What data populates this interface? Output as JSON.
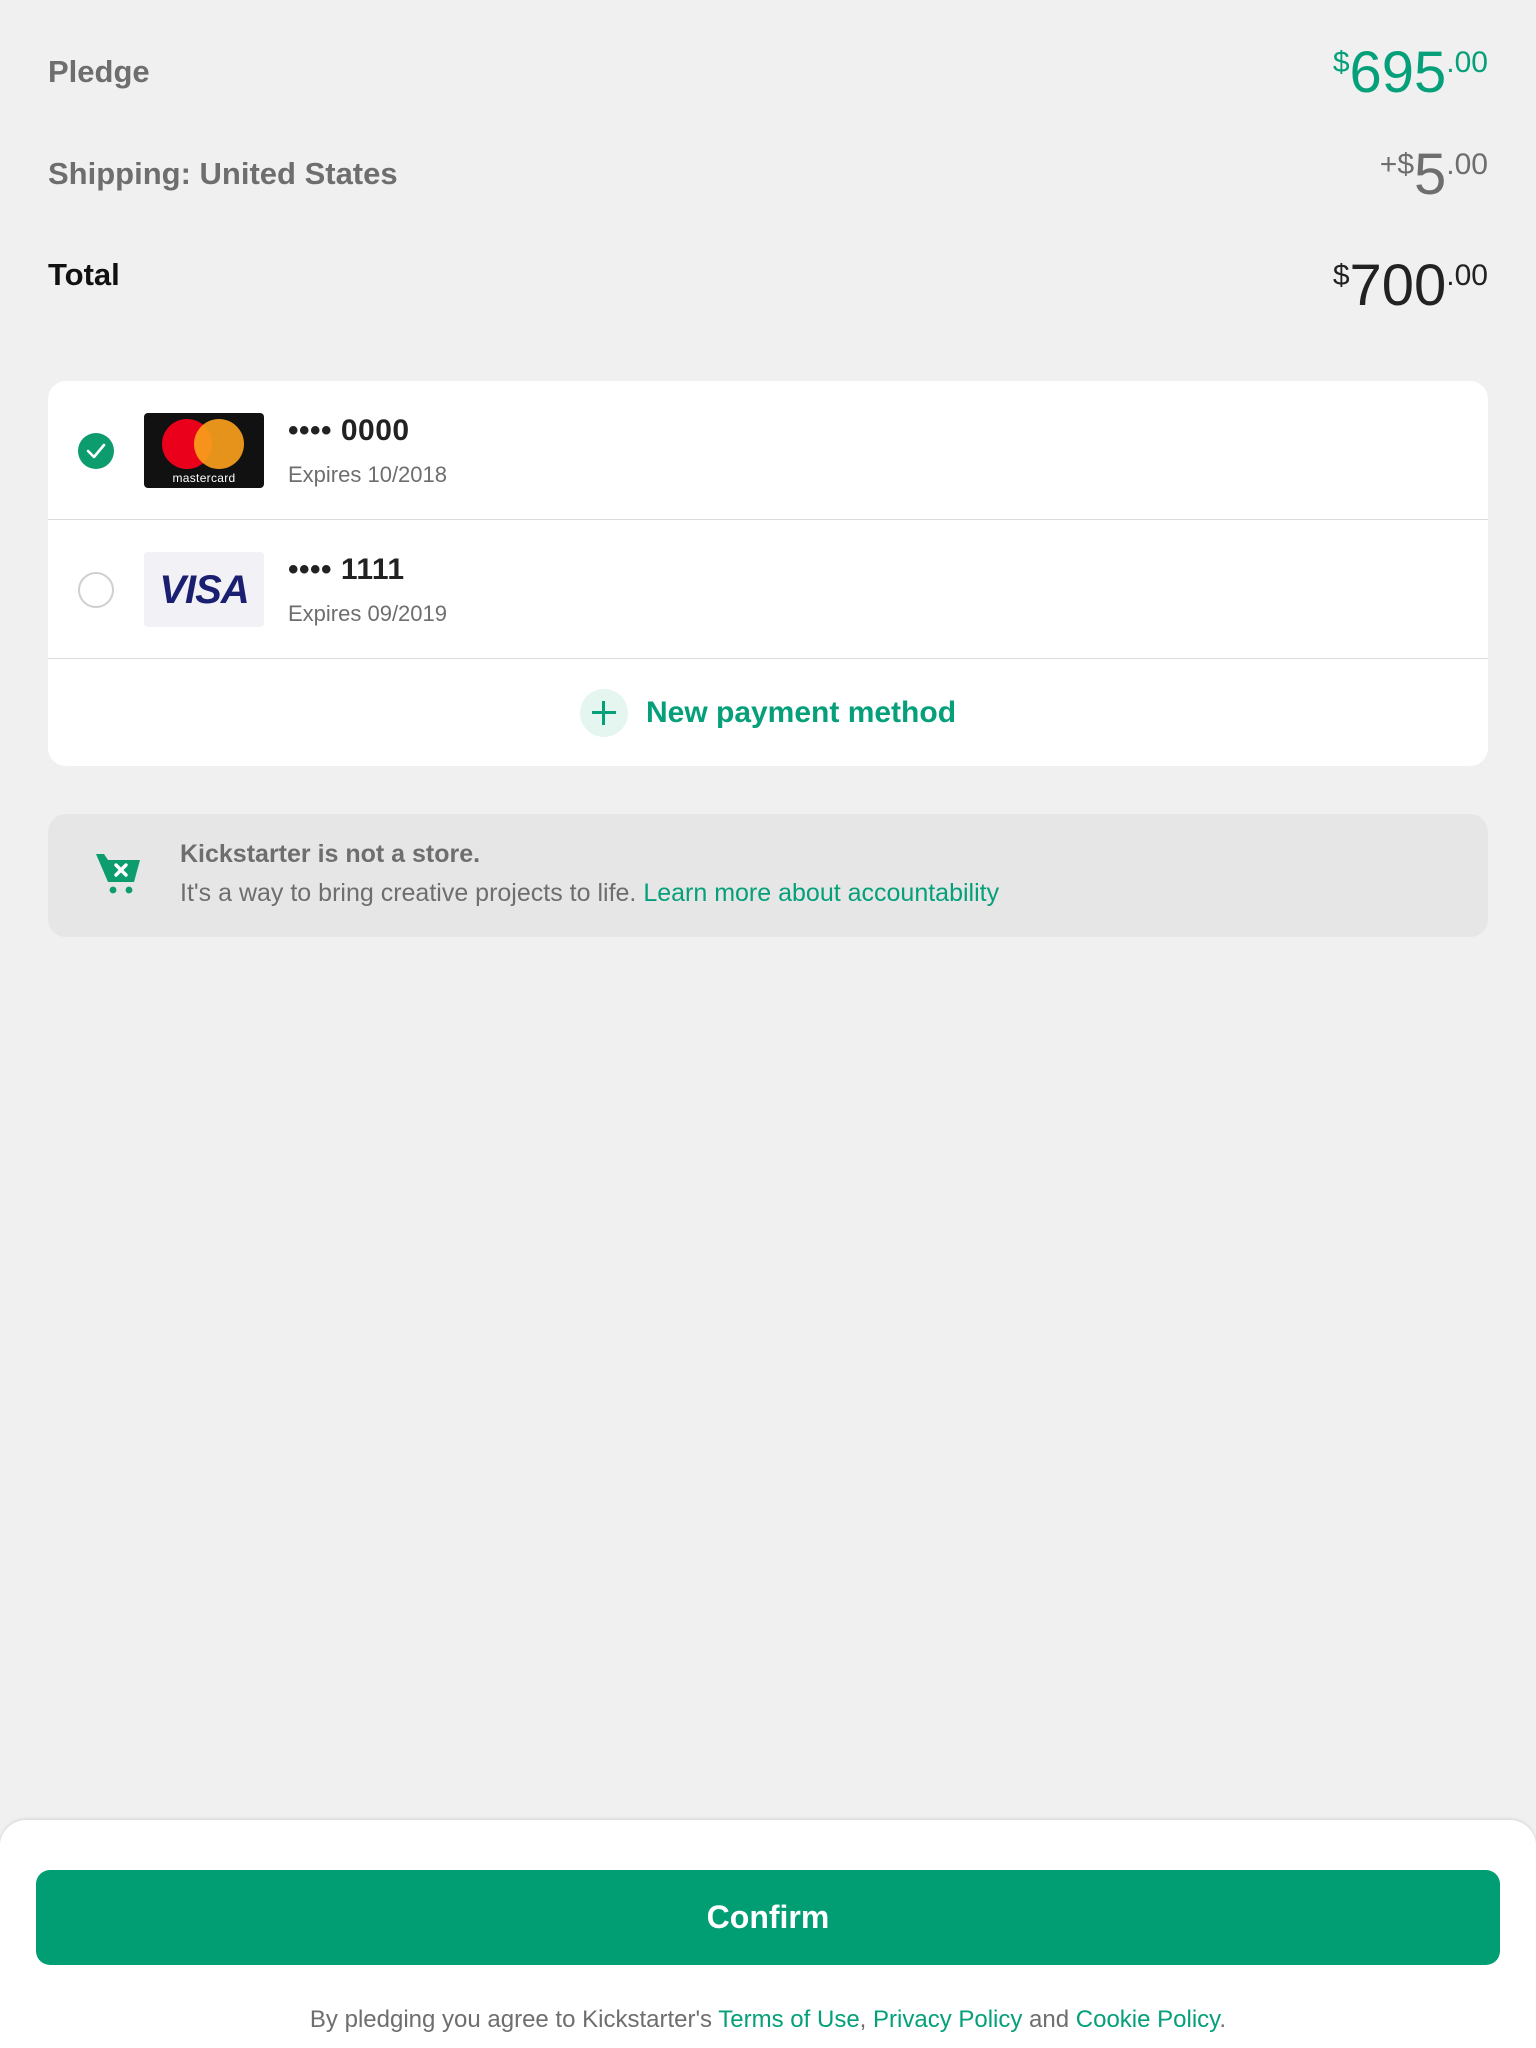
{
  "summary": {
    "pledge": {
      "label": "Pledge",
      "prefix": "",
      "symbol": "$",
      "integer": "695",
      "decimal": ".00"
    },
    "shipping": {
      "label": "Shipping: United States",
      "prefix": "+",
      "symbol": "$",
      "integer": "5",
      "decimal": ".00"
    },
    "total": {
      "label": "Total",
      "prefix": "",
      "symbol": "$",
      "integer": "700",
      "decimal": ".00"
    }
  },
  "payment_methods": {
    "cards": [
      {
        "brand": "mastercard",
        "brand_label": "mastercard",
        "masked_number": "•••• 0000",
        "expires": "Expires 10/2018",
        "selected": true
      },
      {
        "brand": "visa",
        "brand_label": "VISA",
        "masked_number": "•••• 1111",
        "expires": "Expires 09/2019",
        "selected": false
      }
    ],
    "new_method_label": "New payment method"
  },
  "notice": {
    "icon": "cart-x-icon",
    "title": "Kickstarter is not a store.",
    "body": "It's a way to bring creative projects to life. ",
    "link": "Learn more about accountability"
  },
  "footer": {
    "confirm_label": "Confirm",
    "legal_prefix": "By pledging you agree to Kickstarter's ",
    "terms": "Terms of Use",
    "sep1": ", ",
    "privacy": "Privacy Policy",
    "and": " and ",
    "cookie": "Cookie Policy",
    "end": "."
  },
  "colors": {
    "accent": "#05a07a",
    "button": "#029e73",
    "background": "#f0f0f0"
  }
}
